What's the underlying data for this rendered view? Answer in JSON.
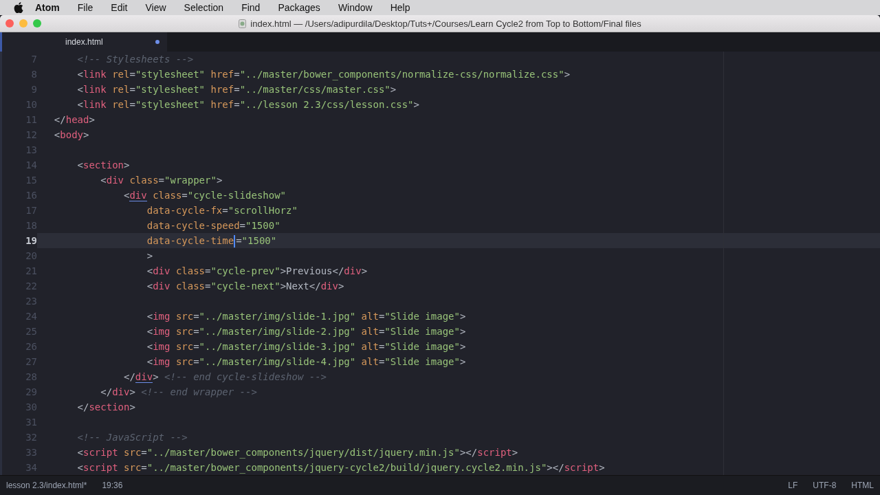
{
  "menu_bar": {
    "items": [
      {
        "label": "Atom",
        "kind": "app"
      },
      {
        "label": "File",
        "kind": "menu"
      },
      {
        "label": "Edit",
        "kind": "menu"
      },
      {
        "label": "View",
        "kind": "menu"
      },
      {
        "label": "Selection",
        "kind": "menu"
      },
      {
        "label": "Find",
        "kind": "menu"
      },
      {
        "label": "Packages",
        "kind": "menu"
      },
      {
        "label": "Window",
        "kind": "menu"
      },
      {
        "label": "Help",
        "kind": "menu"
      }
    ]
  },
  "window": {
    "title": "index.html — /Users/adipurdila/Desktop/Tuts+/Courses/Learn Cycle2 from Top to Bottom/Final files"
  },
  "tabs": [
    {
      "label": "index.html",
      "selected": true,
      "modified": true
    }
  ],
  "lines": [
    {
      "number": "7",
      "current": false,
      "tokens": [
        {
          "kind": "comment",
          "text": "      <!-- Stylesheets -->"
        }
      ]
    },
    {
      "number": "8",
      "current": false,
      "tokens": [
        {
          "kind": "punct",
          "text": "      <"
        },
        {
          "kind": "tag",
          "text": "link"
        },
        {
          "kind": "attr",
          "text": " rel"
        },
        {
          "kind": "punct",
          "text": "="
        },
        {
          "kind": "string",
          "text": "\"stylesheet\""
        },
        {
          "kind": "attr",
          "text": " href"
        },
        {
          "kind": "punct",
          "text": "="
        },
        {
          "kind": "string",
          "text": "\"../master/bower_components/normalize-css/normalize.css\""
        },
        {
          "kind": "punct",
          "text": ">"
        }
      ]
    },
    {
      "number": "9",
      "current": false,
      "tokens": [
        {
          "kind": "punct",
          "text": "      <"
        },
        {
          "kind": "tag",
          "text": "link"
        },
        {
          "kind": "attr",
          "text": " rel"
        },
        {
          "kind": "punct",
          "text": "="
        },
        {
          "kind": "string",
          "text": "\"stylesheet\""
        },
        {
          "kind": "attr",
          "text": " href"
        },
        {
          "kind": "punct",
          "text": "="
        },
        {
          "kind": "string",
          "text": "\"../master/css/master.css\""
        },
        {
          "kind": "punct",
          "text": ">"
        }
      ]
    },
    {
      "number": "10",
      "current": false,
      "tokens": [
        {
          "kind": "punct",
          "text": "      <"
        },
        {
          "kind": "tag",
          "text": "link"
        },
        {
          "kind": "attr",
          "text": " rel"
        },
        {
          "kind": "punct",
          "text": "="
        },
        {
          "kind": "string",
          "text": "\"stylesheet\""
        },
        {
          "kind": "attr",
          "text": " href"
        },
        {
          "kind": "punct",
          "text": "="
        },
        {
          "kind": "string",
          "text": "\"../lesson 2.3/css/lesson.css\""
        },
        {
          "kind": "punct",
          "text": ">"
        }
      ]
    },
    {
      "number": "11",
      "current": false,
      "tokens": [
        {
          "kind": "punct",
          "text": "  </"
        },
        {
          "kind": "tag",
          "text": "head"
        },
        {
          "kind": "punct",
          "text": ">"
        }
      ]
    },
    {
      "number": "12",
      "current": false,
      "tokens": [
        {
          "kind": "punct",
          "text": "  <"
        },
        {
          "kind": "tag",
          "text": "body"
        },
        {
          "kind": "punct",
          "text": ">"
        }
      ]
    },
    {
      "number": "13",
      "current": false
    },
    {
      "number": "14",
      "current": false,
      "tokens": [
        {
          "kind": "punct",
          "text": "      <"
        },
        {
          "kind": "tag",
          "text": "section"
        },
        {
          "kind": "punct",
          "text": ">"
        }
      ]
    },
    {
      "number": "15",
      "current": false,
      "tokens": [
        {
          "kind": "punct",
          "text": "          <"
        },
        {
          "kind": "tag",
          "text": "div"
        },
        {
          "kind": "attr",
          "text": " class"
        },
        {
          "kind": "punct",
          "text": "="
        },
        {
          "kind": "string",
          "text": "\"wrapper\""
        },
        {
          "kind": "punct",
          "text": ">"
        }
      ]
    },
    {
      "number": "16",
      "current": false,
      "tokens": [
        {
          "kind": "punct",
          "text": "              <"
        },
        {
          "kind": "tag",
          "text": "div",
          "matched": true
        },
        {
          "kind": "attr",
          "text": " class"
        },
        {
          "kind": "punct",
          "text": "="
        },
        {
          "kind": "string",
          "text": "\"cycle-slideshow\""
        }
      ]
    },
    {
      "number": "17",
      "current": false,
      "tokens": [
        {
          "kind": "attr",
          "text": "                  data-cycle-fx"
        },
        {
          "kind": "punct",
          "text": "="
        },
        {
          "kind": "string",
          "text": "\"scrollHorz\""
        }
      ]
    },
    {
      "number": "18",
      "current": false,
      "tokens": [
        {
          "kind": "attr",
          "text": "                  data-cycle-speed"
        },
        {
          "kind": "punct",
          "text": "="
        },
        {
          "kind": "string",
          "text": "\"1500\""
        }
      ]
    },
    {
      "number": "19",
      "current": true,
      "tokens": [
        {
          "kind": "attr",
          "text": "                  data-cycle-time"
        },
        {
          "kind": "cursor"
        },
        {
          "kind": "punct",
          "text": "="
        },
        {
          "kind": "string",
          "text": "\"1500\""
        }
      ]
    },
    {
      "number": "20",
      "current": false,
      "tokens": [
        {
          "kind": "punct",
          "text": "                  >"
        }
      ]
    },
    {
      "number": "21",
      "current": false,
      "tokens": [
        {
          "kind": "punct",
          "text": "                  <"
        },
        {
          "kind": "tag",
          "text": "div"
        },
        {
          "kind": "attr",
          "text": " class"
        },
        {
          "kind": "punct",
          "text": "="
        },
        {
          "kind": "string",
          "text": "\"cycle-prev\""
        },
        {
          "kind": "punct",
          "text": ">"
        },
        {
          "kind": "text",
          "text": "Previous"
        },
        {
          "kind": "punct",
          "text": "</"
        },
        {
          "kind": "tag",
          "text": "div"
        },
        {
          "kind": "punct",
          "text": ">"
        }
      ]
    },
    {
      "number": "22",
      "current": false,
      "tokens": [
        {
          "kind": "punct",
          "text": "                  <"
        },
        {
          "kind": "tag",
          "text": "div"
        },
        {
          "kind": "attr",
          "text": " class"
        },
        {
          "kind": "punct",
          "text": "="
        },
        {
          "kind": "string",
          "text": "\"cycle-next\""
        },
        {
          "kind": "punct",
          "text": ">"
        },
        {
          "kind": "text",
          "text": "Next"
        },
        {
          "kind": "punct",
          "text": "</"
        },
        {
          "kind": "tag",
          "text": "div"
        },
        {
          "kind": "punct",
          "text": ">"
        }
      ]
    },
    {
      "number": "23",
      "current": false
    },
    {
      "number": "24",
      "current": false,
      "tokens": [
        {
          "kind": "punct",
          "text": "                  <"
        },
        {
          "kind": "tag",
          "text": "img"
        },
        {
          "kind": "attr",
          "text": " src"
        },
        {
          "kind": "punct",
          "text": "="
        },
        {
          "kind": "string",
          "text": "\"../master/img/slide-1.jpg\""
        },
        {
          "kind": "attr",
          "text": " alt"
        },
        {
          "kind": "punct",
          "text": "="
        },
        {
          "kind": "string",
          "text": "\"Slide image\""
        },
        {
          "kind": "punct",
          "text": ">"
        }
      ]
    },
    {
      "number": "25",
      "current": false,
      "tokens": [
        {
          "kind": "punct",
          "text": "                  <"
        },
        {
          "kind": "tag",
          "text": "img"
        },
        {
          "kind": "attr",
          "text": " src"
        },
        {
          "kind": "punct",
          "text": "="
        },
        {
          "kind": "string",
          "text": "\"../master/img/slide-2.jpg\""
        },
        {
          "kind": "attr",
          "text": " alt"
        },
        {
          "kind": "punct",
          "text": "="
        },
        {
          "kind": "string",
          "text": "\"Slide image\""
        },
        {
          "kind": "punct",
          "text": ">"
        }
      ]
    },
    {
      "number": "26",
      "current": false,
      "tokens": [
        {
          "kind": "punct",
          "text": "                  <"
        },
        {
          "kind": "tag",
          "text": "img"
        },
        {
          "kind": "attr",
          "text": " src"
        },
        {
          "kind": "punct",
          "text": "="
        },
        {
          "kind": "string",
          "text": "\"../master/img/slide-3.jpg\""
        },
        {
          "kind": "attr",
          "text": " alt"
        },
        {
          "kind": "punct",
          "text": "="
        },
        {
          "kind": "string",
          "text": "\"Slide image\""
        },
        {
          "kind": "punct",
          "text": ">"
        }
      ]
    },
    {
      "number": "27",
      "current": false,
      "tokens": [
        {
          "kind": "punct",
          "text": "                  <"
        },
        {
          "kind": "tag",
          "text": "img"
        },
        {
          "kind": "attr",
          "text": " src"
        },
        {
          "kind": "punct",
          "text": "="
        },
        {
          "kind": "string",
          "text": "\"../master/img/slide-4.jpg\""
        },
        {
          "kind": "attr",
          "text": " alt"
        },
        {
          "kind": "punct",
          "text": "="
        },
        {
          "kind": "string",
          "text": "\"Slide image\""
        },
        {
          "kind": "punct",
          "text": ">"
        }
      ]
    },
    {
      "number": "28",
      "current": false,
      "tokens": [
        {
          "kind": "punct",
          "text": "              </"
        },
        {
          "kind": "tag",
          "text": "div",
          "matched": true
        },
        {
          "kind": "punct",
          "text": ">"
        },
        {
          "kind": "comment",
          "text": " <!-- end cycle-slideshow -->"
        }
      ]
    },
    {
      "number": "29",
      "current": false,
      "tokens": [
        {
          "kind": "punct",
          "text": "          </"
        },
        {
          "kind": "tag",
          "text": "div"
        },
        {
          "kind": "punct",
          "text": ">"
        },
        {
          "kind": "comment",
          "text": " <!-- end wrapper -->"
        }
      ]
    },
    {
      "number": "30",
      "current": false,
      "tokens": [
        {
          "kind": "punct",
          "text": "      </"
        },
        {
          "kind": "tag",
          "text": "section"
        },
        {
          "kind": "punct",
          "text": ">"
        }
      ]
    },
    {
      "number": "31",
      "current": false
    },
    {
      "number": "32",
      "current": false,
      "tokens": [
        {
          "kind": "comment",
          "text": "      <!-- JavaScript -->"
        }
      ]
    },
    {
      "number": "33",
      "current": false,
      "tokens": [
        {
          "kind": "punct",
          "text": "      <"
        },
        {
          "kind": "tag",
          "text": "script"
        },
        {
          "kind": "attr",
          "text": " src"
        },
        {
          "kind": "punct",
          "text": "="
        },
        {
          "kind": "string",
          "text": "\"../master/bower_components/jquery/dist/jquery.min.js\""
        },
        {
          "kind": "punct",
          "text": "></"
        },
        {
          "kind": "tag",
          "text": "script"
        },
        {
          "kind": "punct",
          "text": ">"
        }
      ]
    },
    {
      "number": "34",
      "current": false,
      "tokens": [
        {
          "kind": "punct",
          "text": "      <"
        },
        {
          "kind": "tag",
          "text": "script"
        },
        {
          "kind": "attr",
          "text": " src"
        },
        {
          "kind": "punct",
          "text": "="
        },
        {
          "kind": "string",
          "text": "\"../master/bower_components/jquery-cycle2/build/jquery.cycle2.min.js\""
        },
        {
          "kind": "punct",
          "text": "></"
        },
        {
          "kind": "tag",
          "text": "script"
        },
        {
          "kind": "punct",
          "text": ">"
        }
      ]
    }
  ],
  "status_bar": {
    "file": "lesson 2.3/index.html*",
    "position": "19:36",
    "line_ending": "LF",
    "encoding": "UTF-8",
    "grammar": "HTML"
  }
}
